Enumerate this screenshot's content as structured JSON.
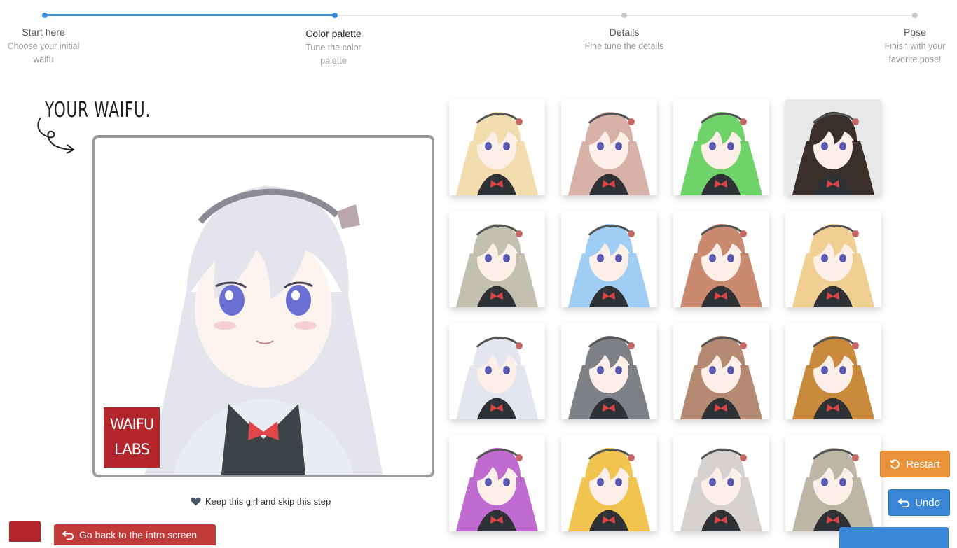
{
  "stepper": {
    "steps": [
      {
        "title": "Start here",
        "desc": "Choose your initial waifu"
      },
      {
        "title": "Color palette",
        "desc": "Tune the color palette"
      },
      {
        "title": "Details",
        "desc": "Fine tune the details"
      },
      {
        "title": "Pose",
        "desc": "Finish with your favorite pose!"
      }
    ]
  },
  "heading": "YOUR WAIFU.",
  "logo": {
    "line1": "WAIFU",
    "line2": "LABS"
  },
  "keep_label": "Keep this girl and skip this step",
  "buttons": {
    "restart": "Restart",
    "undo": "Undo",
    "back": "Go back to the intro screen"
  },
  "colors": {
    "accent": "#3b8de0",
    "restart": "#e8923a",
    "undo": "#3a86d6",
    "brand": "#b3262c"
  },
  "main_hair_color": "#e4e4ec",
  "palette_hair_colors": [
    "#f3dcae",
    "#d8b2a8",
    "#6fd36a",
    "#3a2f2a",
    "#c2c0ae",
    "#9fcdf3",
    "#c98a70",
    "#f1cf92",
    "#e3e6ee",
    "#7e8286",
    "#b58a72",
    "#c98a3e",
    "#c06bd0",
    "#f1c34f",
    "#d6d2cf",
    "#bcb7a5"
  ]
}
